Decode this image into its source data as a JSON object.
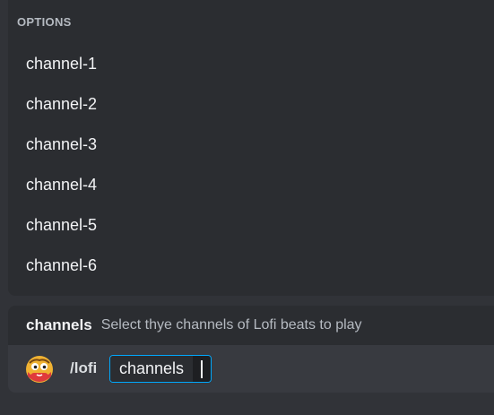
{
  "popup": {
    "header": "OPTIONS",
    "options": [
      "channel-1",
      "channel-2",
      "channel-3",
      "channel-4",
      "channel-5",
      "channel-6"
    ]
  },
  "hint": {
    "param_name": "channels",
    "description": "Select thye channels of Lofi beats to play"
  },
  "command": {
    "avatar_icon": "bot-avatar-icon",
    "name": "/lofi",
    "param_label": "channels",
    "param_value": ""
  },
  "colors": {
    "accent": "#00a8fc",
    "popup_bg": "#2b2d31",
    "page_bg": "#313338"
  }
}
